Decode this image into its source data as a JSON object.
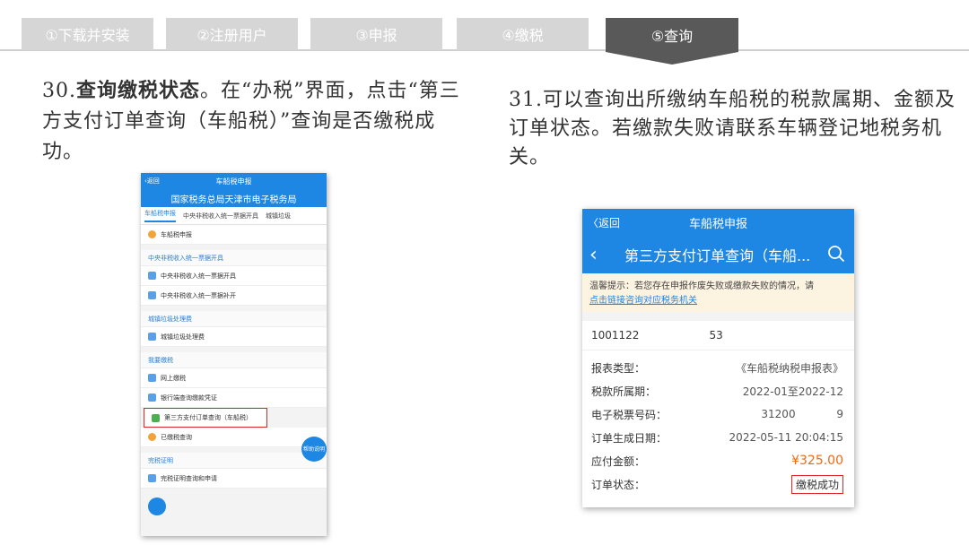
{
  "steps": [
    {
      "label": "①下载并安装"
    },
    {
      "label": "②注册用户"
    },
    {
      "label": "③申报"
    },
    {
      "label": "④缴税"
    },
    {
      "label": "⑤查询"
    }
  ],
  "left_text": {
    "number": "30.",
    "bold": "查询缴税状态",
    "rest": "。在“办税”界面，点击“第三方支付订单查询（车船税）”查询是否缴税成功。"
  },
  "right_text": "31.可以查询出所缴纳车船税的税款属期、金额及订单状态。若缴款失败请联系车辆登记地税务机关。",
  "phone1": {
    "back": "‹返回",
    "title": "车船税申报",
    "banner": "国家税务总局天津市电子税务局",
    "tabs": [
      "车船税申报",
      "中央非税收入统一票据开具",
      "城镇垃圾"
    ],
    "item_declare": "车船税申报",
    "section1": "中央非税收入统一票据开具",
    "item_issue": "中央非税收入统一票据开具",
    "item_reissue": "中央非税收入统一票据补开",
    "section2": "城镇垃圾处理费",
    "item_garbage": "城镇垃圾处理费",
    "section3": "我要缴税",
    "item_online": "网上缴税",
    "item_bank": "银行端查询缴款凭证",
    "item_thirdparty": "第三方支付订单查询（车船税）",
    "item_paid": "已缴税查询",
    "section4": "完税证明",
    "item_cert": "完税证明查询和申请",
    "float_btn": "帮助说明"
  },
  "phone2": {
    "back": "〈返回",
    "title": "车船税申报",
    "header": "第三方支付订单查询（车船...",
    "notice": "温馨提示：若您存在申报作废失败或缴款失败的情况，请",
    "notice_link": "点击链接咨询对应税务机关",
    "order_no": "1001122",
    "order_suffix": "53",
    "rows": [
      {
        "k": "报表类型：",
        "v": "《车船税纳税申报表》"
      },
      {
        "k": "税款所属期：",
        "v": "2022-01至2022-12"
      },
      {
        "k": "电子税票号码：",
        "v": "31200            9"
      },
      {
        "k": "订单生成日期：",
        "v": "2022-05-11 20:04:15"
      }
    ],
    "amount_label": "应付金额：",
    "amount": "¥325.00",
    "status_label": "订单状态：",
    "status": "缴税成功"
  },
  "colors": {
    "accent": "#1e86e3",
    "highlight": "#d9272a",
    "tab_active": "#595959",
    "tab_inactive": "#d6d6d6"
  }
}
